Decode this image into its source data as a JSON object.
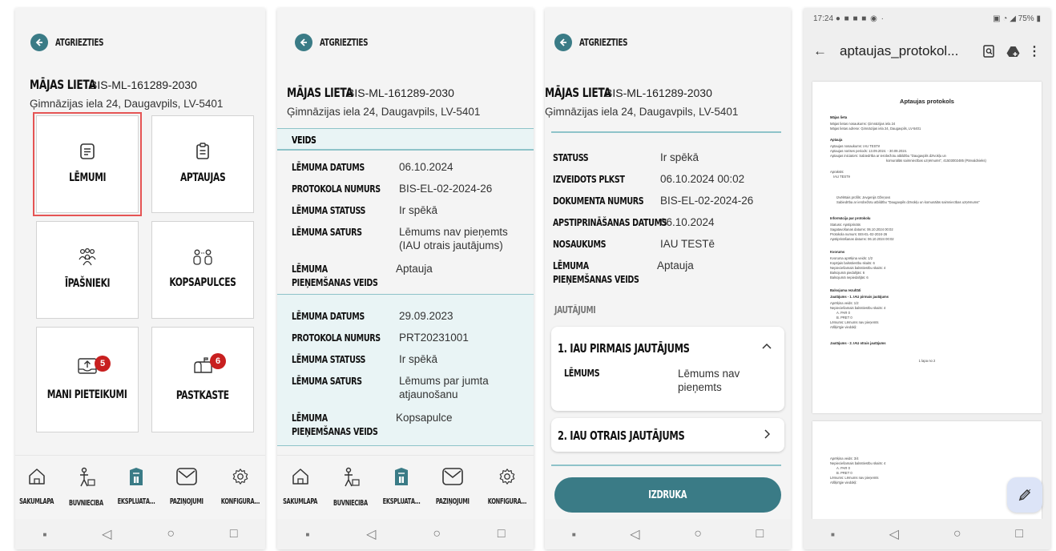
{
  "common": {
    "back_label": "ATGRIEZTIES",
    "house_title": "MĀJAS LIETA",
    "house_number": "BIS-ML-161289-2030",
    "house_address": "Ģimnāzijas iela 24, Daugavpils, LV-5401",
    "nav": [
      "SĀKUMLAPA",
      "BŪVNIECĪBA",
      "EKSPLUATĀ...",
      "PAZIŅOJUMI",
      "KONFIGURĀ..."
    ]
  },
  "screen1": {
    "tiles": [
      {
        "label": "LĒMUMI",
        "icon": "document-icon",
        "selected": true
      },
      {
        "label": "APTAUJAS",
        "icon": "clipboard-icon"
      },
      {
        "label": "ĪPAŠNIEKI",
        "icon": "people-icon"
      },
      {
        "label": "KOPSAPULCES",
        "icon": "meeting-icon"
      },
      {
        "label": "MANI PIETEIKUMI",
        "icon": "upload-tray-icon",
        "badge": "5"
      },
      {
        "label": "PASTKASTE",
        "icon": "mailbox-icon",
        "badge": "6"
      }
    ]
  },
  "screen2": {
    "veids_label": "VEIDS",
    "decisions": [
      {
        "date_label": "LĒMUMA DATUMS",
        "date": "06.10.2024",
        "protocol_label": "PROTOKOLA NUMURS",
        "protocol": "BIS-EL-02-2024-26",
        "status_label": "LĒMUMA STATUSS",
        "status": "Ir spēkā",
        "content_label": "LĒMUMA SATURS",
        "content": "Lēmums nav pieņemts (IAU otrais jautājums)",
        "type_label": "LĒMUMA PIEŅEMŠANAS VEIDS",
        "type": "Aptauja"
      },
      {
        "date_label": "LĒMUMA DATUMS",
        "date": "29.09.2023",
        "protocol_label": "PROTOKOLA NUMURS",
        "protocol": "PRT20231001",
        "status_label": "LĒMUMA STATUSS",
        "status": "Ir spēkā",
        "content_label": "LĒMUMA SATURS",
        "content": "Lēmums par jumta atjaunošanu",
        "type_label": "LĒMUMA PIEŅEMŠANAS VEIDS",
        "type": "Kopsapulce"
      }
    ]
  },
  "screen3": {
    "details": [
      {
        "label": "STATUSS",
        "value": "Ir spēkā"
      },
      {
        "label": "IZVEIDOTS PLKST",
        "value": "06.10.2024 00:02"
      },
      {
        "label": "DOKUMENTA NUMURS",
        "value": "BIS-EL-02-2024-26"
      },
      {
        "label": "APSTIPRINĀŠANAS DATUMS",
        "value": "06.10.2024"
      },
      {
        "label": "NOSAUKUMS",
        "value": "IAU TESTē"
      },
      {
        "label": "LĒMUMA PIEŅEMŠANAS VEIDS",
        "value": "Aptauja"
      }
    ],
    "questions_heading": "JAUTĀJUMI",
    "q1_title": "1. IAU PIRMAIS JAUTĀJUMS",
    "q1_decision_label": "LĒMUMS",
    "q1_decision_value": "Lēmums nav pieņemts",
    "q2_title": "2. IAU OTRAIS JAUTĀJUMS",
    "print_button": "IZDRUKA"
  },
  "screen4": {
    "status_time": "17:24",
    "status_battery": "75%",
    "file_title": "aptaujas_protokol...",
    "doc_title": "Aptaujas protokols",
    "page_indicator": "1 lapa no 2",
    "doc_lines": [
      "Mājas lieta",
      "Mājas lietas nosaukums:   Ģimnāzijas iela 24",
      "Mājas lietas adrese:   Ģimnāzijas iela 24, Daugavpils, LV-5401",
      "Aptauja",
      "Aptaujas nosaukums:   IAU TESTē",
      "Aptaujas norises periods:   13.09.2024. - 30.09.2024.",
      "Aptaujas iniciators:   Sabiedrība ar ierobežotu atbildību \"Daugavpils dzīvokļu un",
      "komunālās saimniecības uzņēmums\", 41503002485 (Pārvaldnieks)",
      "Apraksts:",
      "IAU TESTē",
      "Izvēlētais profils: Jevgenijs Ožeņovs",
      "Sabiedrība ar ierobežotu atbildību \"Daugavpils dzīvokļu un komunālās saimniecības uzņēmums\"",
      "Informācija par protokolu",
      "Statuss:   Apstiprināts",
      "Sagatavošanas datums:   06.10.2024 00:02",
      "Protokola numurs:   BIS-EL-02-2024-26",
      "Apstiprināšanas datums:   06.10.2024 00:02",
      "Kvorums",
      "Kvoruma aprēķina veids:   1/2",
      "Kopējais balsstiesību skaits:   6",
      "Nepieciešamais balsstiesību skaits:   4",
      "Balsojumā piedalījās:   6",
      "Balsojumā nepiedalījās:   6",
      "Balsojuma rezultāti",
      "Jautājums - 1. IAU pirmais jautājums",
      "Aprēķina veids:   1/2",
      "Nepieciešamais balsstiesību skaits:   4",
      "A. PAR   0",
      "B. PRET   0",
      "Lēmums:   Lēmums nav pieņemts",
      "Atšķirīgie viedokļi:",
      "Jautājums - 2. IAU otrais jautājums"
    ],
    "doc_lines_p2": [
      "Aprēķina veids:   3/4",
      "Nepieciešamais balsstiesību skaits:   4",
      "A. PAR   0",
      "B. PRET   0",
      "Lēmums:   Lēmums nav pieņemts",
      "Atšķirīgie viedokļi:"
    ]
  }
}
